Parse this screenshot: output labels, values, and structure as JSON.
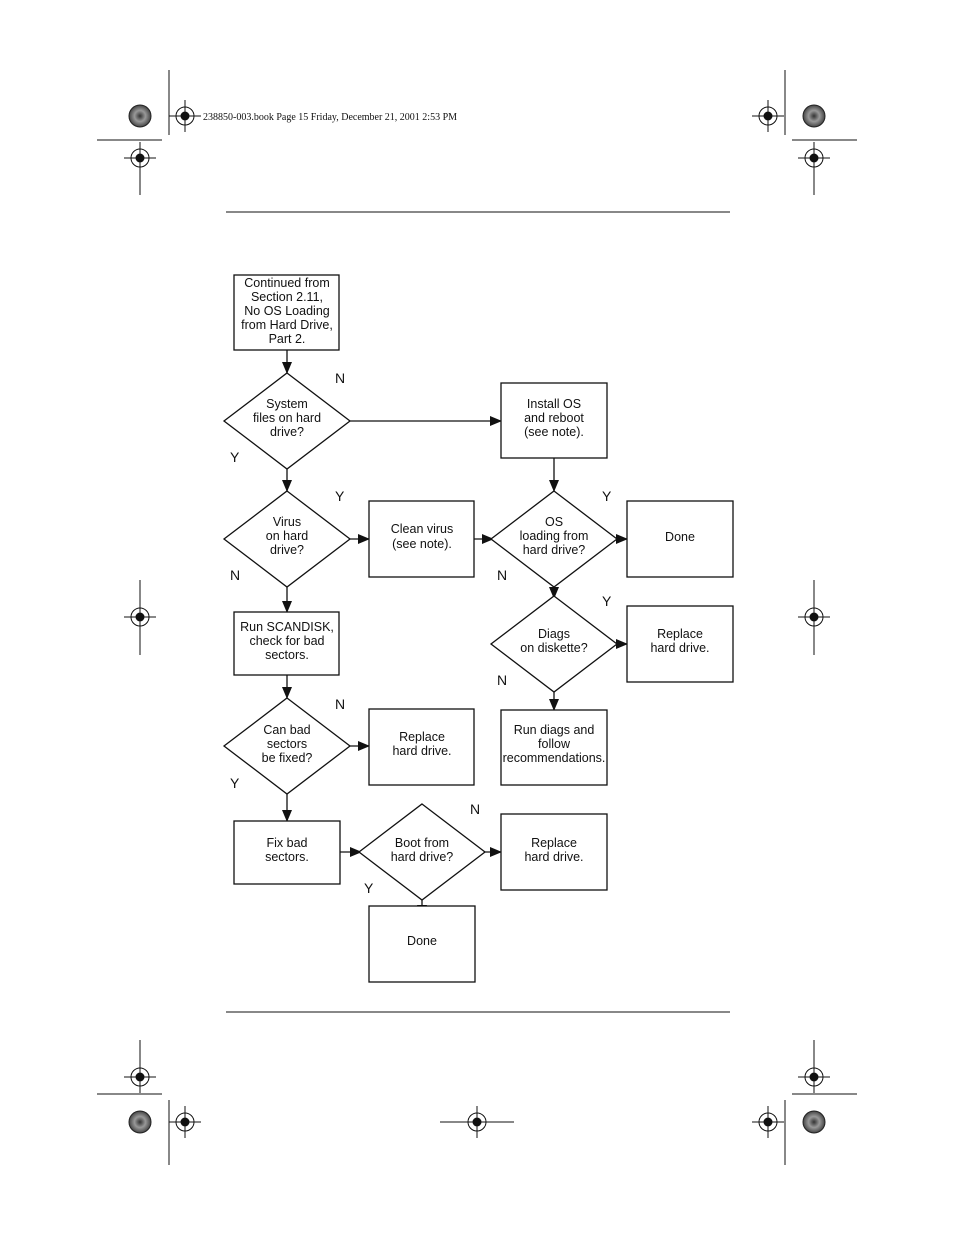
{
  "header": {
    "text": "238850-003.book  Page 15  Friday, December 21, 2001  2:53 PM"
  },
  "nodes": {
    "start": {
      "lines": [
        "Continued from",
        "Section 2.11,",
        "No OS Loading",
        "from Hard Drive,",
        "Part 2."
      ]
    },
    "system_files": {
      "lines": [
        "System",
        "files on hard",
        "drive?"
      ]
    },
    "install_os": {
      "lines": [
        "Install OS",
        "and reboot",
        "(see note)."
      ]
    },
    "virus": {
      "lines": [
        "Virus",
        "on hard",
        "drive?"
      ]
    },
    "clean_virus": {
      "lines": [
        "Clean virus",
        "(see note)."
      ]
    },
    "os_loading": {
      "lines": [
        "OS",
        "loading from",
        "hard drive?"
      ]
    },
    "done_1": {
      "lines": [
        "Done"
      ]
    },
    "diags": {
      "lines": [
        "Diags",
        "on diskette?"
      ]
    },
    "replace_1": {
      "lines": [
        "Replace",
        "hard drive."
      ]
    },
    "run_diags": {
      "lines": [
        "Run diags and",
        "follow",
        "recommendations."
      ]
    },
    "scandisk": {
      "lines": [
        "Run SCANDISK,",
        "check for bad",
        "sectors."
      ]
    },
    "can_fix": {
      "lines": [
        "Can bad",
        "sectors",
        "be fixed?"
      ]
    },
    "replace_2": {
      "lines": [
        "Replace",
        "hard drive."
      ]
    },
    "fix_bad": {
      "lines": [
        "Fix bad",
        "sectors."
      ]
    },
    "boot": {
      "lines": [
        "Boot from",
        "hard drive?"
      ]
    },
    "replace_3": {
      "lines": [
        "Replace",
        "hard drive."
      ]
    },
    "done_2": {
      "lines": [
        "Done"
      ]
    }
  },
  "edge_labels": [
    "N",
    "Y",
    "Y",
    "N",
    "Y",
    "N",
    "Y",
    "N",
    "N",
    "Y",
    "N",
    "Y"
  ]
}
